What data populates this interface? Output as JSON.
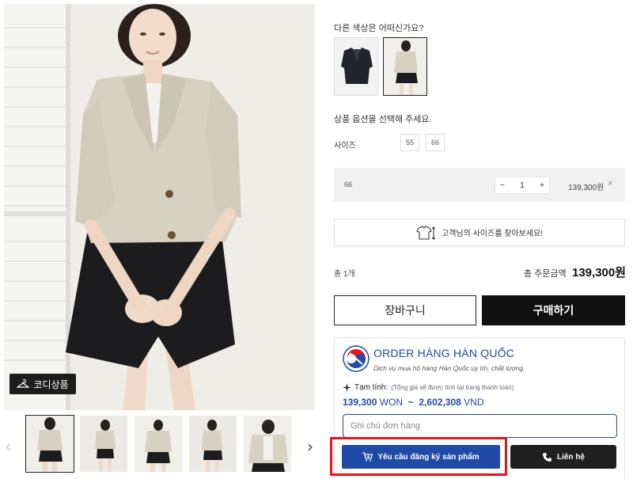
{
  "gallery": {
    "coordi_label": "코디상품",
    "prev_arrow": "‹",
    "next_arrow": "›",
    "thumbnail_count": 6
  },
  "product": {
    "color_question": "다른 색상은 어떠신가요?",
    "option_prompt": "상품 옵션을 선택해 주세요.",
    "size_label": "사이즈",
    "sizes": [
      "55",
      "66"
    ],
    "selected_option": {
      "name": "66",
      "quantity": "1",
      "minus": "−",
      "plus": "+",
      "price": "139,300원",
      "remove": "×"
    },
    "size_finder": "고객님의 사이즈를 찾아보세요!",
    "total_count": "총 1개",
    "total_label": "총 주문금액",
    "total_value": "139,300원",
    "cart_button": "장바구니",
    "buy_button": "구매하기"
  },
  "order_widget": {
    "title": "ORDER HÀNG HÀN QUỐC",
    "subtitle": "Dịch vụ mua hộ hàng Hàn Quốc uy tín, chất lượng.",
    "estimate_label": "Tạm tính:",
    "estimate_note": "(Tổng giá sẽ được tính tại trang thanh toán)",
    "price_krw": "139,300",
    "currency_krw": "WON",
    "tilde": "~",
    "price_vnd": "2,602,308",
    "currency_vnd": "VND",
    "note_placeholder": "Ghi chú đơn hàng",
    "request_button": "Yêu cầu đăng ký sản phẩm",
    "contact_button": "Liên hệ"
  },
  "colors": {
    "brand_blue": "#1f4aa8",
    "highlight_red": "#e8141c",
    "buy_black": "#111111"
  }
}
